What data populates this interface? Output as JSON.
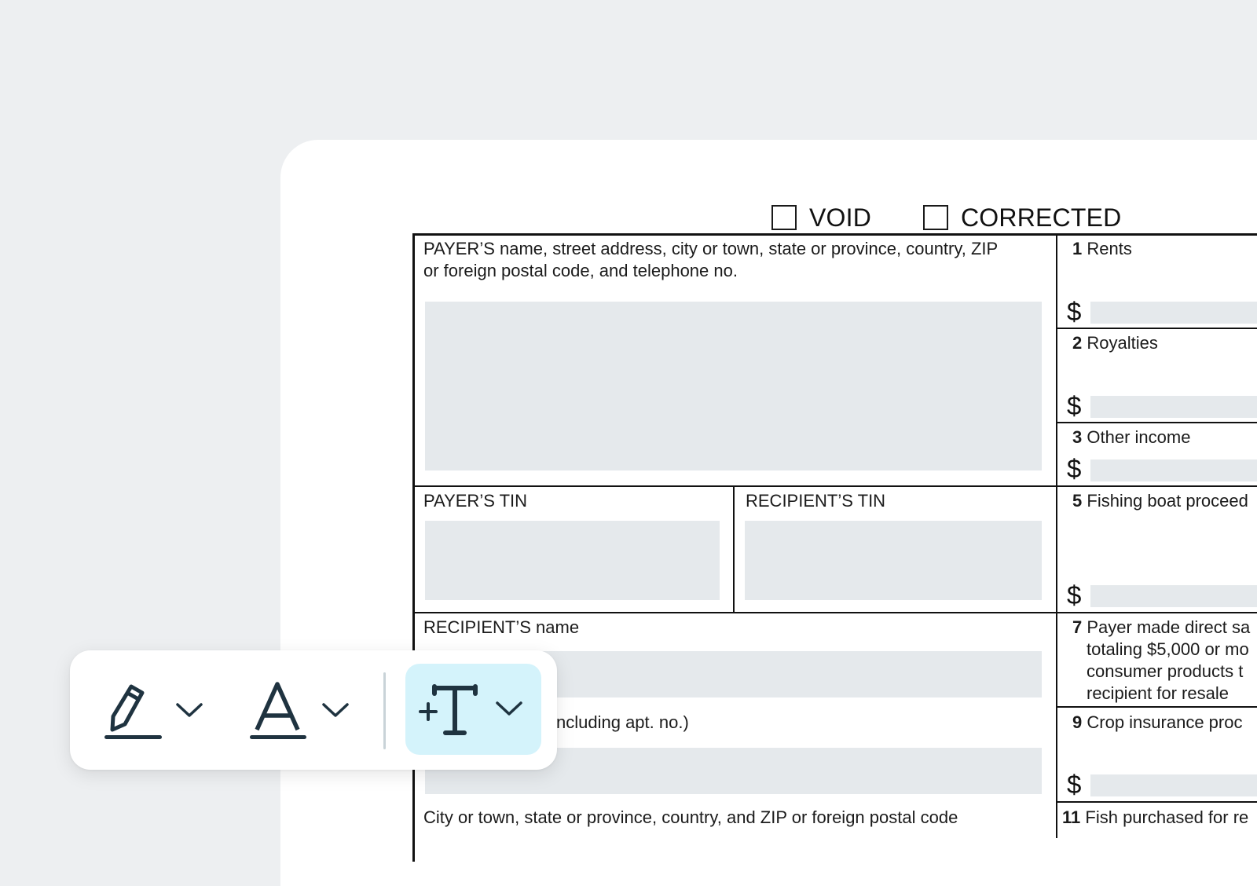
{
  "form": {
    "void_label": "VOID",
    "corrected_label": "CORRECTED",
    "payer_block": {
      "line1": "PAYER’S name, street address, city or town, state or province, country, ZIP",
      "line2": "or foreign postal code, and telephone no."
    },
    "payer_tin": "PAYER’S TIN",
    "recipient_tin": "RECIPIENT’S TIN",
    "recipient_name": "RECIPIENT’S name",
    "street_address_partial": "ncluding apt. no.)",
    "city_line": "City or town, state or province, country, and ZIP or foreign postal code",
    "boxes": [
      {
        "num": "1",
        "label": "Rents",
        "currency": "$"
      },
      {
        "num": "2",
        "label": "Royalties",
        "currency": "$"
      },
      {
        "num": "3",
        "label": "Other income",
        "currency": "$"
      },
      {
        "num": "5",
        "label": "Fishing boat proceed",
        "currency": "$"
      },
      {
        "num": "7",
        "lines": [
          "Payer made direct sa",
          "totaling $5,000 or mo",
          "consumer products t",
          "recipient for resale"
        ]
      },
      {
        "num": "9",
        "label": "Crop insurance proc",
        "currency": "$"
      },
      {
        "num": "11",
        "label": "Fish purchased for re"
      }
    ]
  },
  "toolbar": {
    "tools": [
      {
        "name": "signature",
        "icon": "pen-icon",
        "dropdown": "chevron-down-icon"
      },
      {
        "name": "text-style",
        "icon": "letter-a-icon",
        "dropdown": "chevron-down-icon"
      },
      {
        "name": "add-text",
        "icon": "add-text-icon",
        "dropdown": "chevron-down-icon",
        "active": true
      }
    ],
    "ink_color": "#1f3340",
    "active_bg": "#d4f3fb"
  }
}
